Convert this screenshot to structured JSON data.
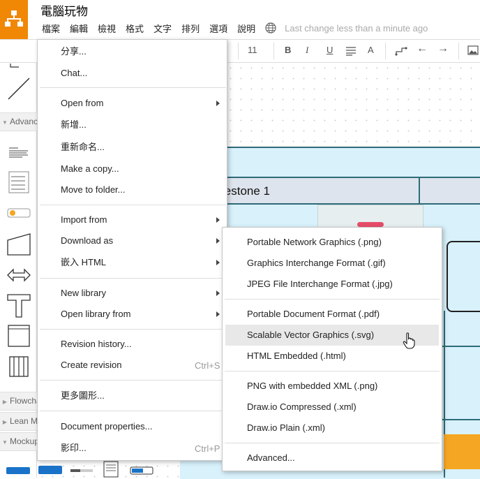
{
  "app": {
    "title": "電腦玩物",
    "menu": [
      "檔案",
      "編輯",
      "檢視",
      "格式",
      "文字",
      "排列",
      "選項",
      "說明"
    ],
    "last_change": "Last change less than a minute ago",
    "accent_color": "#f08705"
  },
  "toolbar": {
    "font_size": "11",
    "bold": "B",
    "italic": "I",
    "underline": "U",
    "font_color": "A",
    "arrow_left": "←",
    "arrow_right": "→"
  },
  "sidebar": {
    "sections": [
      "Advanced",
      "Flowchart",
      "Lean Mapping",
      "Mockups"
    ]
  },
  "canvas": {
    "milestone_label": "lestone 1"
  },
  "file_menu": {
    "items": [
      {
        "label": "分享..."
      },
      {
        "label": "Chat..."
      },
      {
        "label": "Open from",
        "submenu": true
      },
      {
        "label": "新增..."
      },
      {
        "label": "重新命名..."
      },
      {
        "label": "Make a copy..."
      },
      {
        "label": "Move to folder..."
      },
      {
        "label": "Import from",
        "submenu": true
      },
      {
        "label": "Download as",
        "submenu": true
      },
      {
        "label": "嵌入 HTML",
        "submenu": true
      },
      {
        "label": "New library",
        "submenu": true
      },
      {
        "label": "Open library from",
        "submenu": true
      },
      {
        "label": "Revision history..."
      },
      {
        "label": "Create revision",
        "shortcut": "Ctrl+S"
      },
      {
        "label": "更多圖形..."
      },
      {
        "label": "Document properties..."
      },
      {
        "label": "影印...",
        "shortcut": "Ctrl+P"
      }
    ]
  },
  "download_menu": {
    "items": [
      {
        "label": "Portable Network Graphics (.png)"
      },
      {
        "label": "Graphics Interchange Format (.gif)"
      },
      {
        "label": "JPEG File Interchange Format (.jpg)"
      },
      {
        "label": "Portable Document Format (.pdf)"
      },
      {
        "label": "Scalable Vector Graphics (.svg)",
        "highlighted": true
      },
      {
        "label": "HTML Embedded (.html)"
      },
      {
        "label": "PNG with embedded XML (.png)"
      },
      {
        "label": "Draw.io Compressed (.xml)"
      },
      {
        "label": "Draw.io Plain (.xml)"
      },
      {
        "label": "Advanced..."
      }
    ]
  }
}
